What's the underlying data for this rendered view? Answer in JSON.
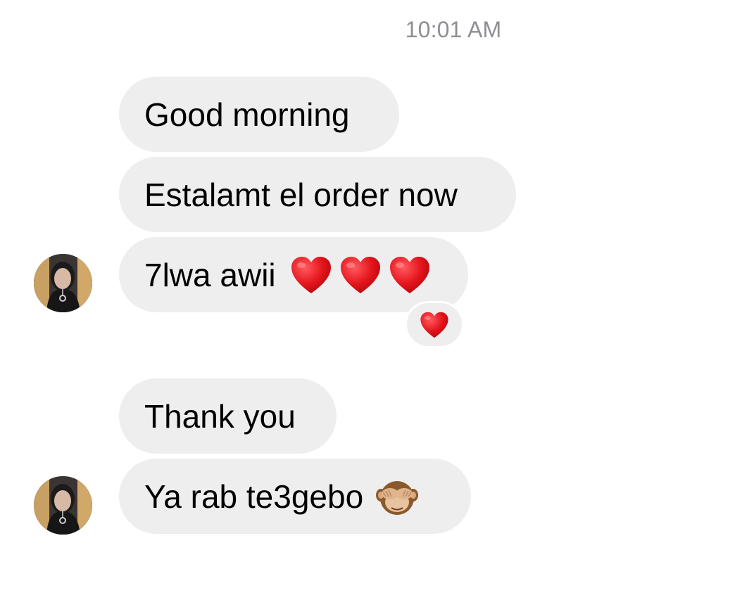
{
  "chat": {
    "timestamp": "10:01 AM",
    "messages": [
      {
        "text": "Good morning"
      },
      {
        "text": "Estalamt el order now"
      },
      {
        "text": "7lwa awii",
        "emoji": [
          "red-heart",
          "red-heart",
          "red-heart"
        ],
        "reaction": "red-heart"
      },
      {
        "text": "Thank you"
      },
      {
        "text": "Ya rab te3gebo",
        "emoji": [
          "see-no-evil-monkey"
        ]
      }
    ]
  },
  "colors": {
    "bubble_bg": "#eeeeef",
    "timestamp": "#8e8e93",
    "heart": "#e4141b"
  }
}
